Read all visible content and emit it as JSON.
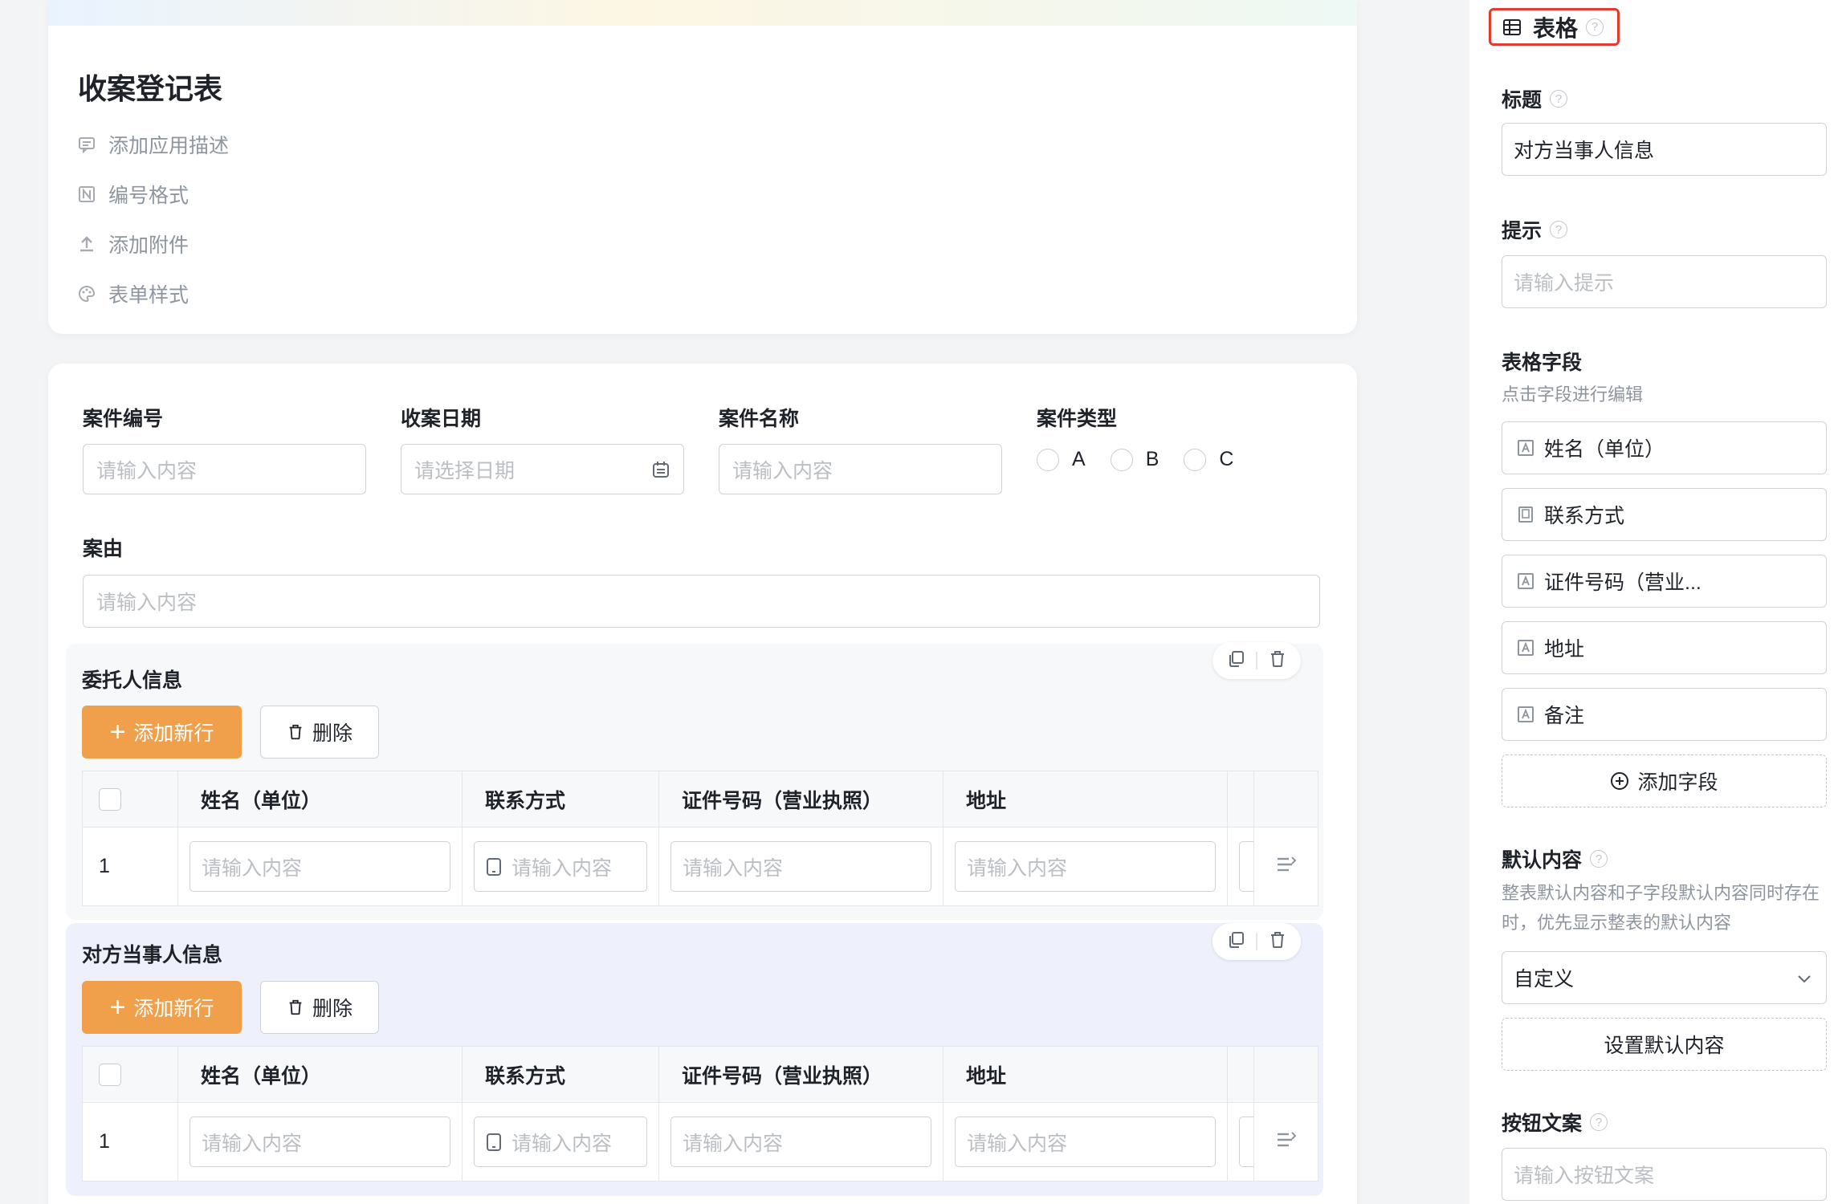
{
  "form": {
    "title": "收案登记表",
    "meta": [
      {
        "label": "添加应用描述",
        "icon": "comment-icon"
      },
      {
        "label": "编号格式",
        "icon": "number-format-icon"
      },
      {
        "label": "添加附件",
        "icon": "upload-icon"
      },
      {
        "label": "表单样式",
        "icon": "palette-icon"
      }
    ]
  },
  "fields": {
    "case_no": {
      "label": "案件编号",
      "placeholder": "请输入内容"
    },
    "date": {
      "label": "收案日期",
      "placeholder": "请选择日期"
    },
    "case_name": {
      "label": "案件名称",
      "placeholder": "请输入内容"
    },
    "case_type": {
      "label": "案件类型",
      "options": [
        "A",
        "B",
        "C"
      ]
    },
    "cause": {
      "label": "案由",
      "placeholder": "请输入内容"
    }
  },
  "sections": [
    {
      "title": "委托人信息",
      "add_label": "添加新行",
      "delete_label": "删除",
      "columns": [
        "姓名（单位）",
        "联系方式",
        "证件号码（营业执照）",
        "地址"
      ],
      "row_index": "1",
      "cell_placeholder": "请输入内容"
    },
    {
      "title": "对方当事人信息",
      "add_label": "添加新行",
      "delete_label": "删除",
      "columns": [
        "姓名（单位）",
        "联系方式",
        "证件号码（营业执照）",
        "地址"
      ],
      "row_index": "1",
      "cell_placeholder": "请输入内容"
    }
  ],
  "panel": {
    "tab_label": "表格",
    "title_label": "标题",
    "title_value": "对方当事人信息",
    "hint_label": "提示",
    "hint_placeholder": "请输入提示",
    "fields_label": "表格字段",
    "fields_desc": "点击字段进行编辑",
    "field_items": [
      "姓名（单位）",
      "联系方式",
      "证件号码（营业...",
      "地址",
      "备注"
    ],
    "add_field_label": "添加字段",
    "default_label": "默认内容",
    "default_desc": "整表默认内容和子字段默认内容同时存在时，优先显示整表的默认内容",
    "default_select": "自定义",
    "set_default_label": "设置默认内容",
    "button_text_label": "按钮文案",
    "button_text_placeholder": "请输入按钮文案"
  },
  "colors": {
    "accent": "#f0a04b",
    "highlight_border": "#e23b30",
    "selected_section_bg": "#eef1fb"
  }
}
